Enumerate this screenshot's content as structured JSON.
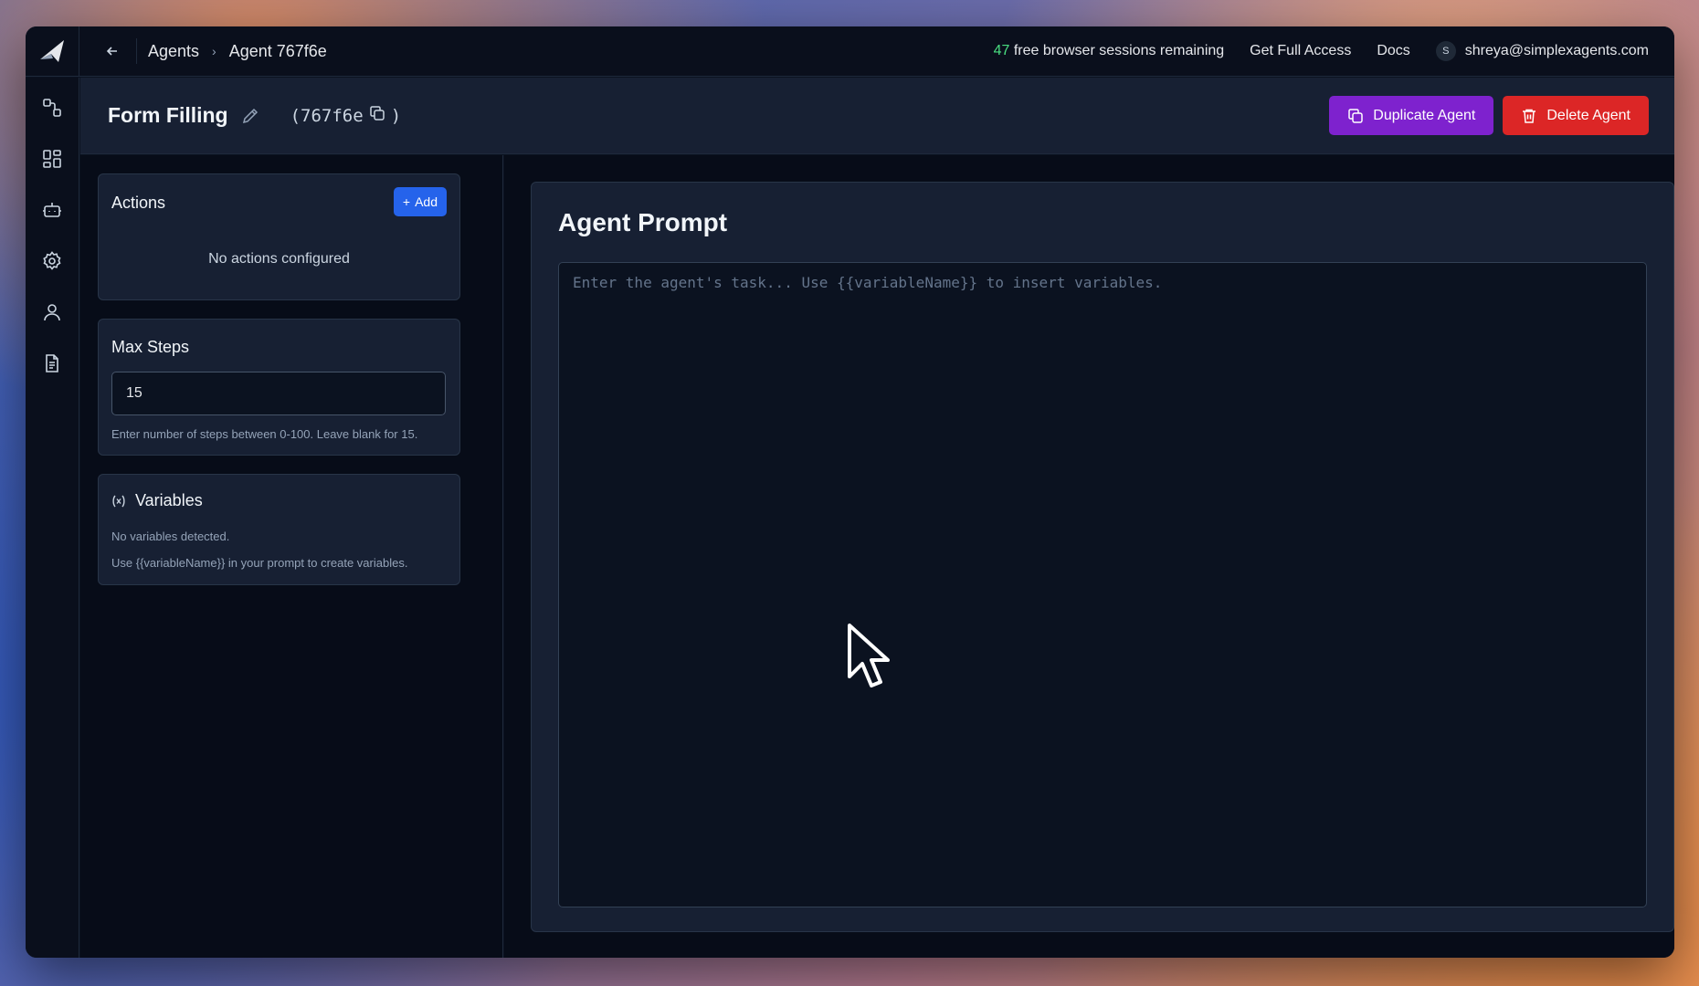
{
  "topbar": {
    "breadcrumbs": [
      "Agents",
      "Agent 767f6e"
    ],
    "sessions_count": "47",
    "sessions_text": "free browser sessions remaining",
    "get_full_access": "Get Full Access",
    "docs": "Docs",
    "user_initial": "S",
    "user_email": "shreya@simplexagents.com"
  },
  "rail": {
    "icons": [
      "workflow-icon",
      "dashboard-icon",
      "bot-icon",
      "settings-icon",
      "user-icon",
      "document-icon"
    ]
  },
  "header": {
    "agent_name": "Form Filling",
    "agent_id_open": "(767f6e",
    "agent_id_close": ")",
    "duplicate_label": "Duplicate Agent",
    "delete_label": "Delete Agent"
  },
  "actions": {
    "title": "Actions",
    "add_label": "Add",
    "empty_text": "No actions configured"
  },
  "max_steps": {
    "title": "Max Steps",
    "value": "15",
    "hint": "Enter number of steps between 0-100. Leave blank for 15."
  },
  "variables": {
    "title": "Variables",
    "empty_text": "No variables detected.",
    "hint": "Use {{variableName}} in your prompt to create variables."
  },
  "prompt": {
    "title": "Agent Prompt",
    "placeholder": "Enter the agent's task... Use {{variableName}} to insert variables."
  },
  "colors": {
    "accent_blue": "#2563eb",
    "duplicate_purple": "#7e22ce",
    "delete_red": "#dc2626",
    "sessions_green": "#4ade80"
  }
}
